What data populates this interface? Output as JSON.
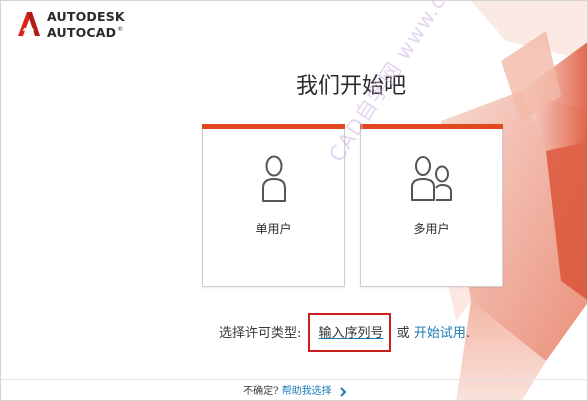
{
  "brand": {
    "line1": "AUTODESK",
    "line2": "AUTOCAD",
    "trademark": "®",
    "logo_icon": "autodesk-a-logo",
    "accent_color": "#e2481e"
  },
  "heading": "我们开始吧",
  "cards": {
    "single": {
      "label": "单用户",
      "icon": "single-user-icon"
    },
    "multi": {
      "label": "多用户",
      "icon": "multi-user-icon"
    }
  },
  "license": {
    "prefix": "选择许可类型:",
    "serial_label": "输入序列号",
    "or_text": " 或 ",
    "trial_label": "开始试用",
    "suffix": ".",
    "highlight_color": "#cc1f1f",
    "link_color": "#1b7ab5"
  },
  "footer": {
    "question": "不确定?",
    "help_label": "帮助我选择",
    "chevron_icon": "chevron-right-icon"
  },
  "watermark": "CAD自学网 www.cadzxw.com"
}
